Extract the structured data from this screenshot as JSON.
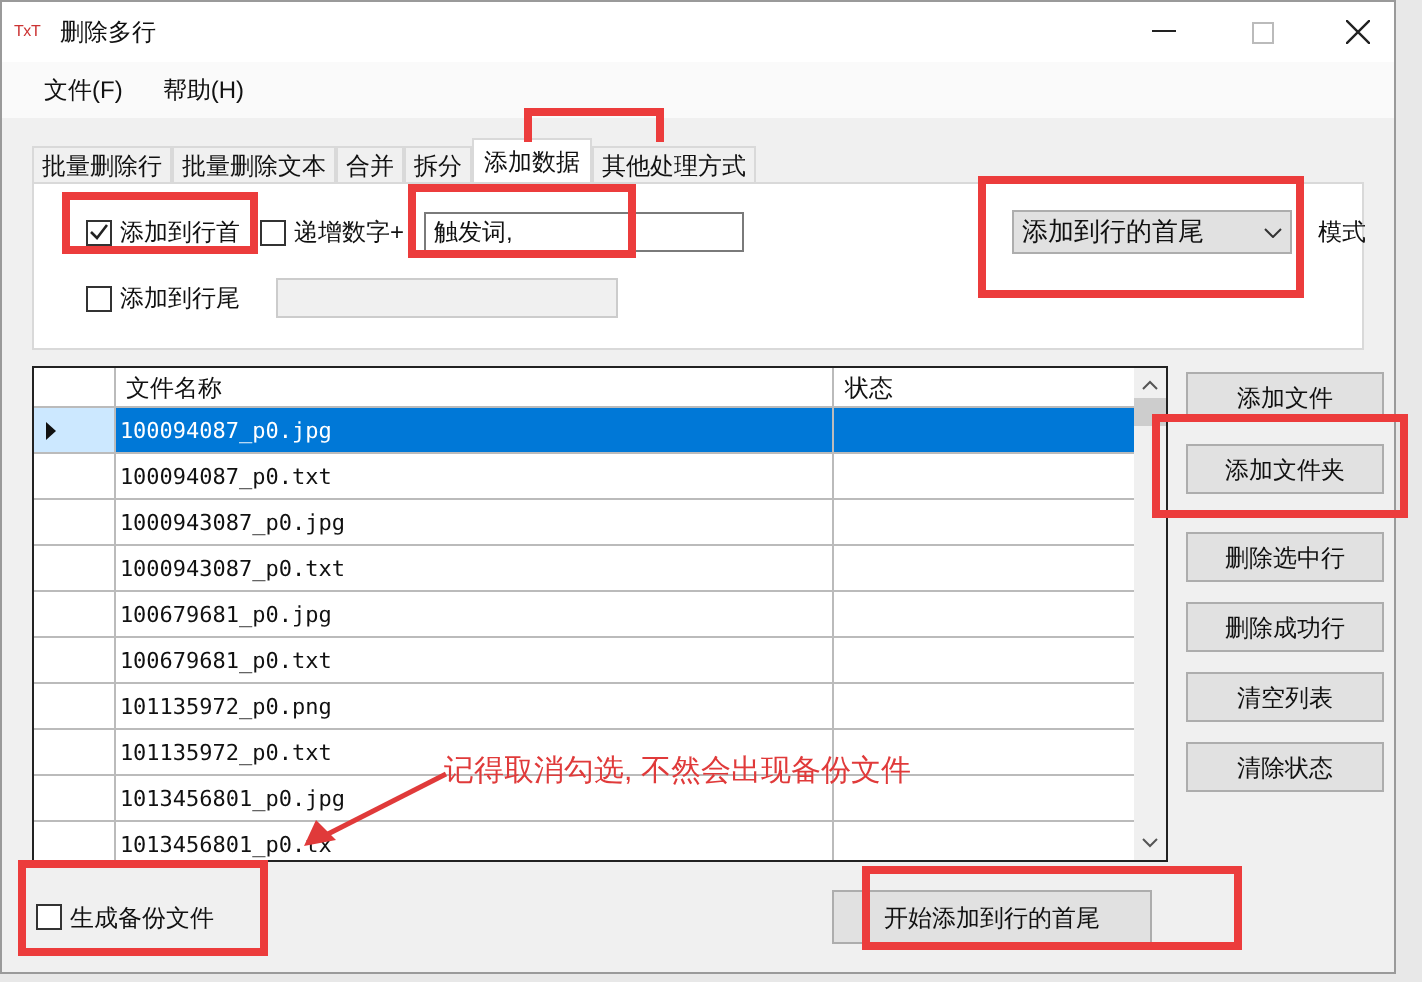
{
  "window": {
    "logo": "TxT",
    "title": "删除多行"
  },
  "menu": [
    {
      "label": "文件(F)"
    },
    {
      "label": "帮助(H)"
    }
  ],
  "tabs": [
    {
      "label": "批量删除行",
      "selected": false
    },
    {
      "label": "批量删除文本",
      "selected": false
    },
    {
      "label": "合并",
      "selected": false
    },
    {
      "label": "拆分",
      "selected": false
    },
    {
      "label": "添加数据",
      "selected": true
    },
    {
      "label": "其他处理方式",
      "selected": false
    }
  ],
  "options": {
    "add_to_start": {
      "label": "添加到行首",
      "checked": true
    },
    "increment": {
      "label": "递增数字+",
      "checked": false
    },
    "prefix_value": "触发词,",
    "mode": {
      "value": "添加到行的首尾",
      "label": "模式"
    },
    "add_to_end": {
      "label": "添加到行尾",
      "checked": false
    },
    "suffix_field": {
      "disabled": true
    }
  },
  "table": {
    "columns": [
      "文件名称",
      "状态"
    ],
    "rows": [
      {
        "file_name": "100094087_p0.jpg",
        "selected": true
      },
      {
        "file_name": "100094087_p0.txt",
        "selected": false
      },
      {
        "file_name": "1000943087_p0.jpg",
        "selected": false
      },
      {
        "file_name": "1000943087_p0.txt",
        "selected": false
      },
      {
        "file_name": "100679681_p0.jpg",
        "selected": false
      },
      {
        "file_name": "100679681_p0.txt",
        "selected": false
      },
      {
        "file_name": "101135972_p0.png",
        "selected": false
      },
      {
        "file_name": "101135972_p0.txt",
        "selected": false
      },
      {
        "file_name": "1013456801_p0.jpg",
        "selected": false
      },
      {
        "file_name": "1013456801_p0.tx",
        "selected": false
      }
    ]
  },
  "side_buttons": [
    "添加文件",
    "添加文件夹",
    "删除选中行",
    "删除成功行",
    "清空列表",
    "清除状态"
  ],
  "backup": {
    "label": "生成备份文件",
    "checked": false
  },
  "start_button": "开始添加到行的首尾",
  "annotation": {
    "text": "记得取消勾选, 不然会出现备份文件"
  }
}
